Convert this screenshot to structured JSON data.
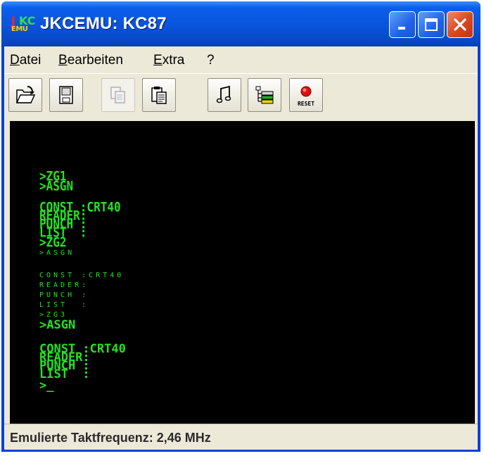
{
  "window": {
    "title": "JKCEMU: KC87",
    "icon": {
      "line1_a": "J",
      "line1_b": "KC",
      "line2": "EMU"
    }
  },
  "menu": [
    "Datei",
    "Bearbeiten",
    "Extra",
    "?"
  ],
  "toolbar": {
    "buttons": [
      {
        "icon": "open-folder-icon",
        "enabled": true
      },
      {
        "icon": "save-disk-icon",
        "enabled": true
      },
      {
        "icon": "copy-icon",
        "enabled": false
      },
      {
        "icon": "paste-icon",
        "enabled": true
      },
      {
        "icon": "audio-note-icon",
        "enabled": true
      },
      {
        "icon": "tree-list-icon",
        "enabled": true
      },
      {
        "icon": "reset-icon",
        "enabled": true,
        "label": "RESET"
      }
    ]
  },
  "terminal": {
    "color": "#21e51f",
    "lines": [
      {
        "text": ">ZG1",
        "style": "tall"
      },
      {
        "text": ">ASGN",
        "style": "tall"
      },
      {
        "text": "CONST :CRT40",
        "style": "tall"
      },
      {
        "text": "READER:",
        "style": "tall"
      },
      {
        "text": "PUNCH :",
        "style": "tall"
      },
      {
        "text": "LIST  :",
        "style": "tall"
      },
      {
        "text": ">ZG2",
        "style": "tall"
      },
      {
        "text": ">ASGN",
        "style": "small"
      },
      {
        "text": "CONST :CRT40",
        "style": "small"
      },
      {
        "text": "READER:",
        "style": "small"
      },
      {
        "text": "PUNCH :",
        "style": "small"
      },
      {
        "text": "LIST  :",
        "style": "small"
      },
      {
        "text": ">ZG3",
        "style": "small"
      },
      {
        "text": ">ASGN",
        "style": "bold2"
      },
      {
        "text": "CONST :CRT40",
        "style": "bold2"
      },
      {
        "text": "READER:",
        "style": "bold2"
      },
      {
        "text": "PUNCH :",
        "style": "bold2"
      },
      {
        "text": "LIST  :",
        "style": "bold2"
      },
      {
        "text": ">_",
        "style": "bold2"
      }
    ]
  },
  "status": {
    "text": "Emulierte Taktfrequenz: 2,46 MHz"
  }
}
